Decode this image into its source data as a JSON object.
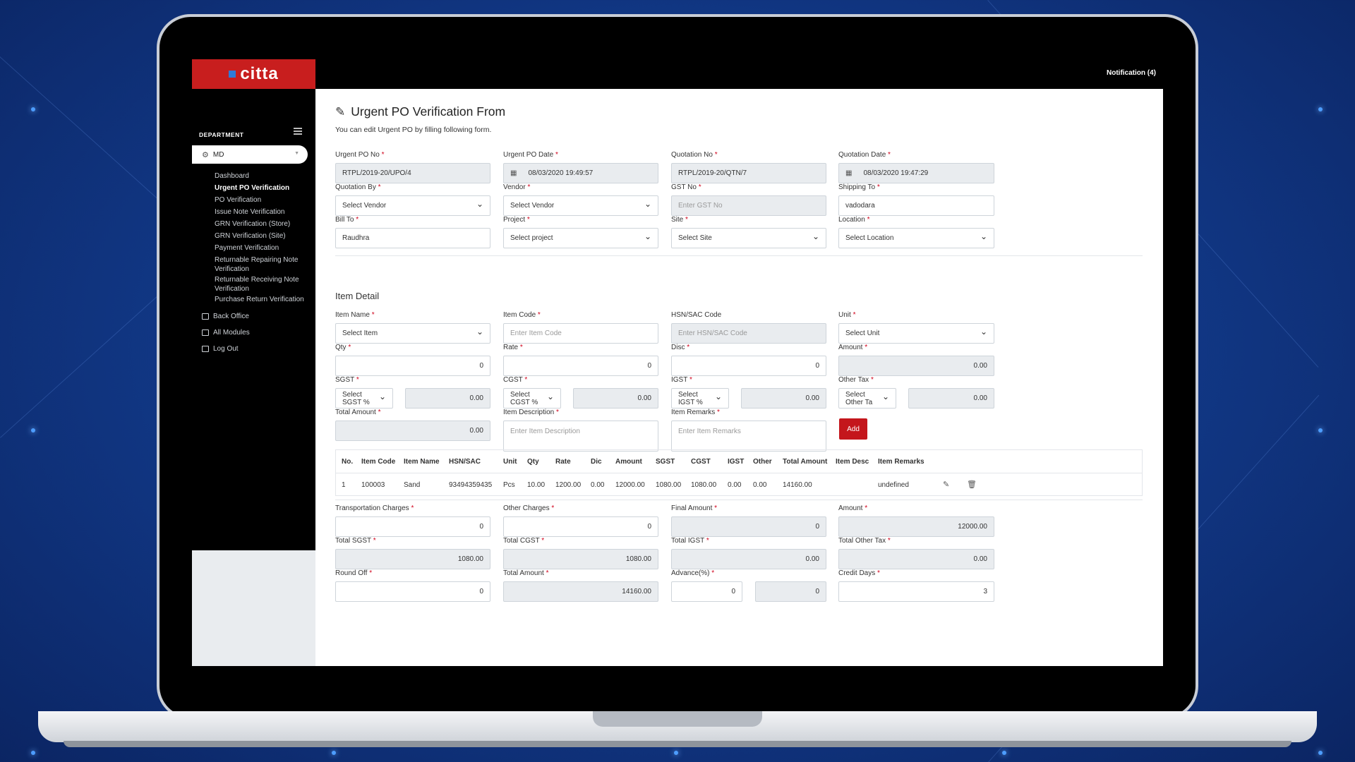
{
  "app": {
    "logo": "citta",
    "notification": "Notification (4)"
  },
  "sidebar": {
    "department_label": "DEPARTMENT",
    "department": "MD",
    "items": [
      "Dashboard",
      "Urgent PO Verification",
      "PO Verification",
      "Issue Note Verification",
      "GRN Verification (Store)",
      "GRN Verification (Site)",
      "Payment Verification",
      "Returnable Repairing Note Verification",
      "Returnable Receiving Note Verification",
      "Purchase Return Verification"
    ],
    "modules": [
      "Back Office",
      "All Modules",
      "Log Out"
    ]
  },
  "page": {
    "title": "Urgent PO Verification From",
    "subtitle": "You can edit Urgent PO by filling following form."
  },
  "form": {
    "urgent_po_no": {
      "label": "Urgent PO No",
      "value": "RTPL/2019-20/UPO/4"
    },
    "urgent_po_date": {
      "label": "Urgent PO Date",
      "value": "08/03/2020 19:49:57"
    },
    "quotation_no": {
      "label": "Quotation No",
      "value": "RTPL/2019-20/QTN/7"
    },
    "quotation_date": {
      "label": "Quotation Date",
      "value": "08/03/2020 19:47:29"
    },
    "quotation_by": {
      "label": "Quotation By",
      "value": "Select Vendor"
    },
    "vendor": {
      "label": "Vendor",
      "value": "Select Vendor"
    },
    "gst_no": {
      "label": "GST No",
      "placeholder": "Enter GST No"
    },
    "shipping_to": {
      "label": "Shipping To",
      "value": "vadodara"
    },
    "bill_to": {
      "label": "Bill To",
      "value": "Raudhra"
    },
    "project": {
      "label": "Project",
      "value": "Select project"
    },
    "site": {
      "label": "Site",
      "value": "Select Site"
    },
    "location": {
      "label": "Location",
      "value": "Select Location"
    }
  },
  "item_detail": {
    "heading": "Item Detail",
    "item_name": {
      "label": "Item Name",
      "value": "Select Item"
    },
    "item_code": {
      "label": "Item Code",
      "placeholder": "Enter Item Code"
    },
    "hsn_sac": {
      "label": "HSN/SAC Code",
      "placeholder": "Enter HSN/SAC Code"
    },
    "unit": {
      "label": "Unit",
      "value": "Select Unit"
    },
    "qty": {
      "label": "Qty",
      "value": "0"
    },
    "rate": {
      "label": "Rate",
      "value": "0"
    },
    "disc": {
      "label": "Disc",
      "value": "0"
    },
    "amount": {
      "label": "Amount",
      "value": "0.00"
    },
    "sgst": {
      "label": "SGST",
      "select": "Select SGST %",
      "value": "0.00"
    },
    "cgst": {
      "label": "CGST",
      "select": "Select CGST %",
      "value": "0.00"
    },
    "igst": {
      "label": "IGST",
      "select": "Select IGST %",
      "value": "0.00"
    },
    "other_tax": {
      "label": "Other Tax",
      "select": "Select Other Ta",
      "value": "0.00"
    },
    "total_amount": {
      "label": "Total Amount",
      "value": "0.00"
    },
    "item_description": {
      "label": "Item Description",
      "placeholder": "Enter Item Description"
    },
    "item_remarks": {
      "label": "Item Remarks",
      "placeholder": "Enter Item Remarks"
    },
    "add_button": "Add"
  },
  "table": {
    "headers": [
      "No.",
      "Item Code",
      "Item Name",
      "HSN/SAC",
      "Unit",
      "Qty",
      "Rate",
      "Dic",
      "Amount",
      "SGST",
      "CGST",
      "IGST",
      "Other",
      "Total Amount",
      "Item Desc",
      "Item Remarks"
    ],
    "rows": [
      [
        "1",
        "100003",
        "Sand",
        "93494359435",
        "Pcs",
        "10.00",
        "1200.00",
        "0.00",
        "12000.00",
        "1080.00",
        "1080.00",
        "0.00",
        "0.00",
        "14160.00",
        "",
        "undefined"
      ]
    ]
  },
  "totals": {
    "transportation_charges": {
      "label": "Transportation Charges",
      "value": "0"
    },
    "other_charges": {
      "label": "Other Charges",
      "value": "0"
    },
    "final_amount": {
      "label": "Final Amount",
      "value": "0"
    },
    "amount": {
      "label": "Amount",
      "value": "12000.00"
    },
    "total_sgst": {
      "label": "Total SGST",
      "value": "1080.00"
    },
    "total_cgst": {
      "label": "Total CGST",
      "value": "1080.00"
    },
    "total_igst": {
      "label": "Total IGST",
      "value": "0.00"
    },
    "total_other_tax": {
      "label": "Total Other Tax",
      "value": "0.00"
    },
    "round_off": {
      "label": "Round Off",
      "value": "0"
    },
    "total_amount": {
      "label": "Total Amount",
      "value": "14160.00"
    },
    "advance": {
      "label": "Advance(%)",
      "value": "0",
      "value2": "0"
    },
    "credit_days": {
      "label": "Credit Days",
      "value": "3"
    }
  },
  "required_mark": "*",
  "colors": {
    "brand": "#c81e1e",
    "accent_button": "#c4161c",
    "background": "#123a8a"
  }
}
